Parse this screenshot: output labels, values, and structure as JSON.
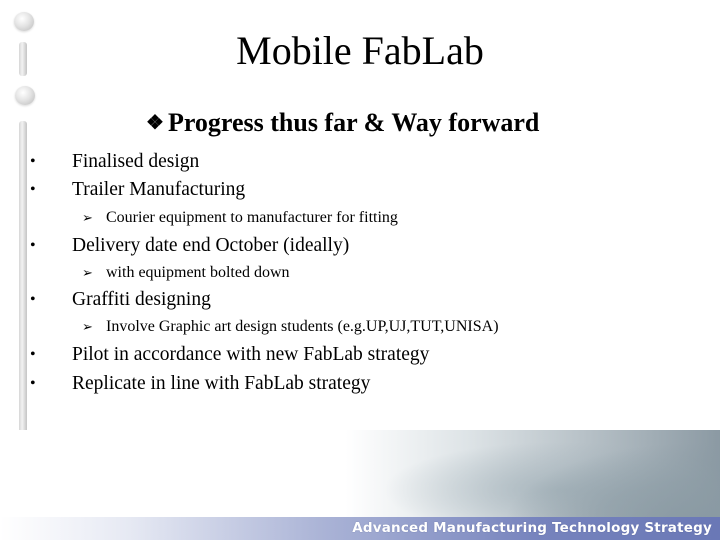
{
  "slide": {
    "title": "Mobile FabLab",
    "subtitle": {
      "icon": "diamond-bullet-icon",
      "glyph": "❖",
      "text": "Progress thus far & Way forward"
    },
    "bullet_glyph": "•",
    "sub_bullet_glyph": "➢",
    "items": [
      {
        "text": "Finalised design"
      },
      {
        "text": "Trailer Manufacturing",
        "sub": "Courier equipment to manufacturer for fitting"
      },
      {
        "text": "Delivery date end October (ideally)",
        "sub": "with equipment bolted down"
      },
      {
        "text": "Graffiti designing",
        "sub": "Involve Graphic art design students (e.g.UP,UJ,TUT,UNISA)"
      },
      {
        "text": "Pilot in accordance with new FabLab strategy"
      },
      {
        "text": "Replicate in line with FabLab strategy"
      }
    ]
  },
  "footer": {
    "banner_text": "Advanced Manufacturing Technology Strategy",
    "banner_color": "#6a78b6"
  }
}
